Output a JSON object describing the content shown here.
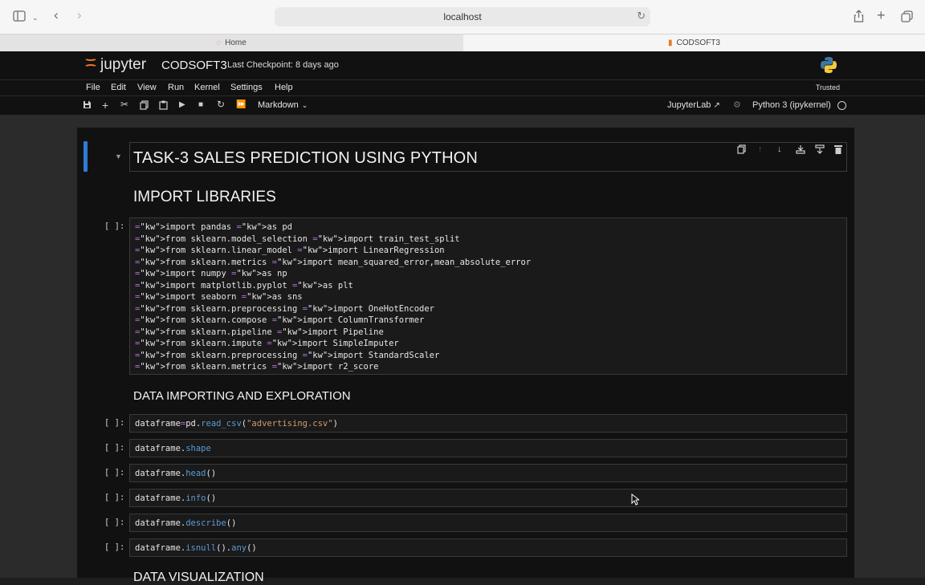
{
  "browser": {
    "url": "localhost",
    "tabs": [
      {
        "label": "Home",
        "active": false
      },
      {
        "label": "CODSOFT3",
        "active": true
      }
    ]
  },
  "jupyter": {
    "logo_text": "jupyter",
    "notebook_title": "CODSOFT3",
    "checkpoint": "Last Checkpoint: 8 days ago",
    "menu": [
      "File",
      "Edit",
      "View",
      "Run",
      "Kernel",
      "Settings",
      "Help"
    ],
    "trusted": "Trusted",
    "cell_type": "Markdown",
    "jupyterlab_link": "JupyterLab",
    "kernel_name": "Python 3 (ipykernel)",
    "colors": {
      "accent": "#2f7bd8",
      "logo_orange": "#f37626",
      "keyword": "#58c858",
      "function": "#5a9bd5",
      "string": "#d39b6a"
    }
  },
  "notebook": {
    "heading_main": "TASK-3 SALES PREDICTION USING PYTHON",
    "heading_import": "IMPORT LIBRARIES",
    "heading_data": "DATA IMPORTING AND EXPLORATION",
    "heading_viz": "DATA VISUALIZATION",
    "prompt": "[ ]:",
    "import_lines": [
      "import pandas as pd",
      "from sklearn.model_selection import train_test_split",
      "from sklearn.linear_model import LinearRegression",
      "from sklearn.metrics import mean_squared_error,mean_absolute_error",
      "import numpy as np",
      "import matplotlib.pyplot as plt",
      "import seaborn as sns",
      "from sklearn.preprocessing import OneHotEncoder",
      "from sklearn.compose import ColumnTransformer",
      "from sklearn.pipeline import Pipeline",
      "from sklearn.impute import SimpleImputer",
      "from sklearn.preprocessing import StandardScaler",
      "from sklearn.metrics import r2_score"
    ],
    "cells": [
      "dataframe=pd.read_csv(\"advertising.csv\")",
      "dataframe.shape",
      "dataframe.head()",
      "dataframe.info()",
      "dataframe.describe()",
      "dataframe.isnull().any()"
    ]
  }
}
